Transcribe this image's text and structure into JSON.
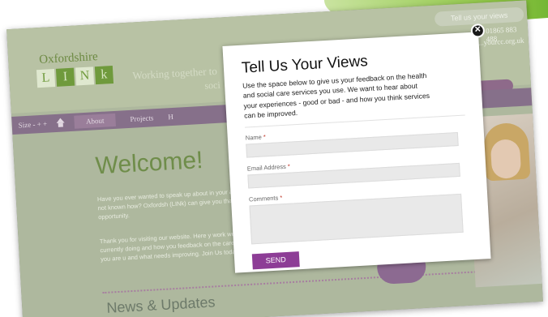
{
  "site": {
    "logo_top": "Oxfordshire",
    "logo_letters": [
      "L",
      "I",
      "N",
      "k"
    ],
    "tagline_line1": "Working together to",
    "tagline_line2": "soci",
    "tell_us_pill": "Tell us your views",
    "phone": "01865 883 488",
    "email": "...yourcc.org.uk",
    "nav": {
      "size_label": "Size - + +",
      "items": [
        "About",
        "Projects",
        "H"
      ]
    },
    "welcome": "Welcome!",
    "para1": "Have you ever wanted to speak up about in your area but not known how? Oxfordsh (LINk) can give you that opportunity.",
    "para2": "Thank you for visiting our website. Here y work we are currently doing and how you feedback on the care services you are u and what needs improving. Join Us today",
    "news_heading": "News & Updates"
  },
  "modal": {
    "title": "Tell Us Your Views",
    "intro": "Use the space below to give us your feedback on the health and social care services you use. We want to hear about your experiences - good or bad - and how you think services can be improved.",
    "fields": {
      "name_label": "Name",
      "email_label": "Email Address",
      "comments_label": "Comments",
      "required_marker": "*"
    },
    "send_label": "SEND",
    "close_glyph": "✕"
  },
  "colors": {
    "accent_purple": "#8d3d96",
    "brand_green": "#6f9a3c",
    "corner_green": "#8cc63f"
  }
}
